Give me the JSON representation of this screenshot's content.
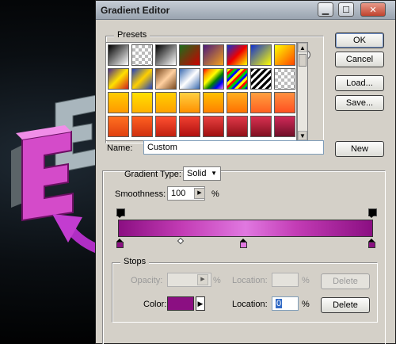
{
  "window": {
    "title": "Gradient Editor"
  },
  "presets": {
    "label": "Presets",
    "menu_icon": "triangle-right-icon"
  },
  "buttons": {
    "ok": "OK",
    "cancel": "Cancel",
    "load": "Load...",
    "save": "Save...",
    "new": "New",
    "delete_opacity": "Delete",
    "delete_color": "Delete"
  },
  "name": {
    "label": "Name:",
    "value": "Custom"
  },
  "gradient_type": {
    "label": "Gradient Type:",
    "value": "Solid"
  },
  "smoothness": {
    "label": "Smoothness:",
    "value": "100",
    "unit": "%"
  },
  "stops": {
    "label": "Stops",
    "opacity_label": "Opacity:",
    "opacity_value": "",
    "opacity_unit": "%",
    "location_label_top": "Location:",
    "location_value_top": "",
    "location_unit_top": "%",
    "color_label": "Color:",
    "color_value": "#8b0f82",
    "location_label_bottom": "Location:",
    "location_value_bottom": "0",
    "location_unit_bottom": "%"
  },
  "colors": {
    "gradient_dark": "#8b0f82",
    "gradient_light": "#e078e0",
    "stop_colors": [
      "#8b0f82",
      "#e078e0",
      "#8b0f82"
    ]
  }
}
